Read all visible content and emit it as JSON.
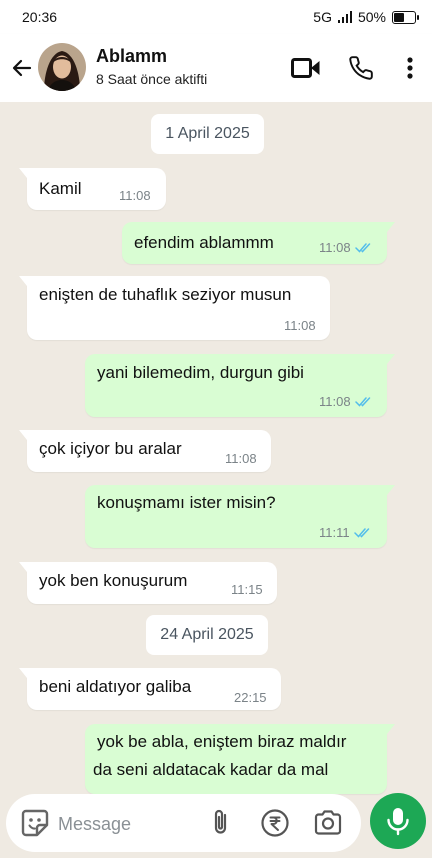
{
  "status_bar": {
    "time": "20:36",
    "network": "5G",
    "battery": "50%",
    "battery_level": 0.5
  },
  "header": {
    "contact_name": "Ablamm",
    "contact_status": "8 Saat önce aktifti",
    "icons": [
      "back-arrow-icon",
      "avatar",
      "video-call-icon",
      "phone-icon",
      "more-options-icon"
    ]
  },
  "chat": {
    "dates": [
      "1 April 2025",
      "24 April 2025"
    ],
    "messages": [
      {
        "dir": "in",
        "text": "Kamil",
        "time": "11:08"
      },
      {
        "dir": "out",
        "text": "efendim ablammm",
        "time": "11:08",
        "read": true
      },
      {
        "dir": "in",
        "text": "enişten de tuhaflık seziyor musun",
        "time": "11:08"
      },
      {
        "dir": "out",
        "text": "yani bilemedim, durgun gibi",
        "time": "11:08",
        "read": true
      },
      {
        "dir": "in",
        "text": "çok içiyor bu aralar",
        "time": "11:08"
      },
      {
        "dir": "out",
        "text": "konuşmamı ister misin?",
        "time": "11:11",
        "read": true
      },
      {
        "dir": "in",
        "text": "yok ben konuşurum",
        "time": "11:15"
      },
      {
        "dir": "in",
        "text": "beni aldatıyor galiba",
        "time": "22:15"
      },
      {
        "dir": "out",
        "text_line1": "yok be abla, eniştem biraz maldır",
        "text_line2": "da seni aldatacak kadar da mal"
      }
    ],
    "read_color": "#53bdeb"
  },
  "composer": {
    "placeholder": "Message",
    "icons": [
      "emoji-sticker-icon",
      "attach-icon",
      "payment-rupee-icon",
      "camera-icon",
      "mic-icon"
    ]
  },
  "colors": {
    "incoming": "#ffffff",
    "outgoing": "#d9fdd3",
    "chat_bg": "#efeae2",
    "mic_button": "#1da855"
  }
}
